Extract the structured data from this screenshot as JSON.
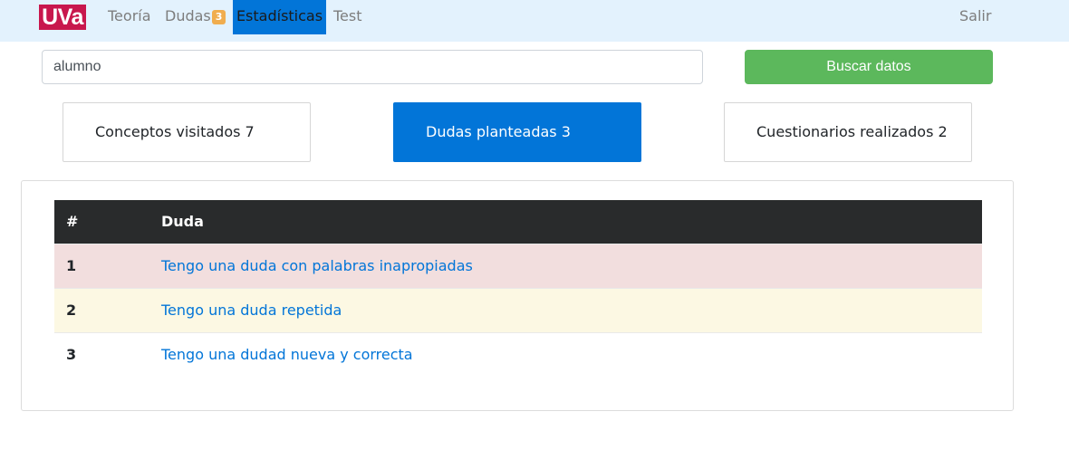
{
  "navbar": {
    "logo_text": "UVa",
    "links": {
      "teoria": "Teoría",
      "dudas": "Dudas",
      "dudas_badge": "3",
      "estadisticas": "Estadísticas",
      "test": "Test",
      "salir": "Salir"
    },
    "active": "Estadísticas"
  },
  "search": {
    "value": "alumno",
    "button_label": "Buscar datos"
  },
  "stats": {
    "conceptos": "Conceptos visitados 7",
    "dudas": "Dudas planteadas 3",
    "cuestionarios": "Cuestionarios realizados 2",
    "active": "Dudas planteadas 3"
  },
  "table": {
    "headers": [
      "#",
      "Duda"
    ],
    "rows": [
      {
        "num": "1",
        "duda": "Tengo una duda con palabras inapropiadas",
        "status_color": "#f2dede"
      },
      {
        "num": "2",
        "duda": "Tengo una duda repetida",
        "status_color": "#fcf8e3"
      },
      {
        "num": "3",
        "duda": "Tengo una dudad nueva y correcta",
        "status_color": "#ffffff"
      }
    ]
  },
  "colors": {
    "navbar_bg": "#e3f2fd",
    "logo_bg": "#c8174d",
    "primary": "#0275d8",
    "success": "#5cb85c",
    "badge": "#f0ad4e",
    "table_header": "#292b2c"
  }
}
